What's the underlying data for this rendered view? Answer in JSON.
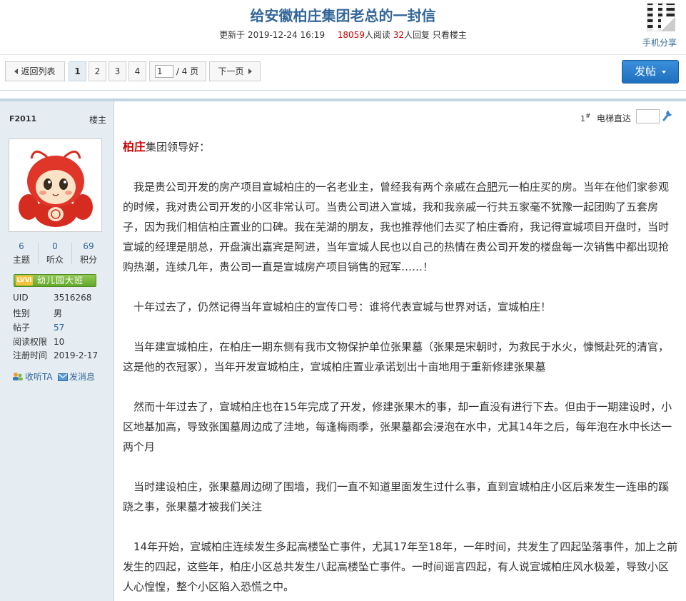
{
  "header": {
    "title": "给安徽柏庄集团老总的一封信",
    "updated_label": "更新于",
    "updated_time": "2019-12-24 16:19",
    "views": "18059",
    "views_label": "人阅读",
    "replies": "32",
    "replies_label": "人回复",
    "only_author": "只看楼主",
    "mobile_share": "手机分享"
  },
  "pager": {
    "back_label": "返回列表",
    "pages": [
      "1",
      "2",
      "3",
      "4"
    ],
    "current_page": "1",
    "jump_value": "1",
    "total_pages": "/ 4 页",
    "next_label": "下一页",
    "post_label": "发帖"
  },
  "author": {
    "name": "F2011",
    "tag": "楼主",
    "stats": {
      "topics": "6",
      "topics_label": "主题",
      "listeners": "0",
      "listeners_label": "听众",
      "points": "69",
      "points_label": "积分"
    },
    "level_badge": "LVⅥ",
    "level_name": "幼儿园大班",
    "info": {
      "uid_label": "UID",
      "uid": "3516268",
      "gender_label": "性别",
      "gender": "男",
      "posts_label": "帖子",
      "posts": "57",
      "perm_label": "阅读权限",
      "perm": "10",
      "reg_label": "注册时间",
      "reg": "2019-2-17"
    },
    "follow_label": "收听TA",
    "message_label": "发消息"
  },
  "post": {
    "floor": "1",
    "floor_mark": "#",
    "elevator_label": "电梯直达",
    "greeting_red": "柏庄",
    "greeting_rest": "集团领导好：",
    "p1_a": "我是贵公司开发的房产项目宣城柏庄的一名老业主，曾经我有两个亲戚在",
    "p1_ul": "合肥",
    "p1_b": "元一柏庄买的房。当年在他们家参观的时候，我对贵公司开发的小区非常认可。当贵公司进入宣城，我和我亲戚一行共五家毫不犹豫一起团购了五套房子，因为我们相信柏庄置业的口碑。我在芜湖的朋友，我也推荐他们去买了柏庄香府，我记得宣城项目开盘时，当时宣城的经理是朋总，开盘演出嘉宾是阿进，当年宣城人民也以自己的热情在贵公司开发的楼盘每一次销售中都出现抢购热潮，连续几年，贵公司一直是宣城房产项目销售的冠军……！",
    "p2": "十年过去了，仍然记得当年宣城柏庄的宣传口号：谁将代表宣城与世界对话，宣城柏庄！",
    "p3": "当年建宣城柏庄，在柏庄一期东侧有我市文物保护单位张果墓（张果是宋朝时，为救民于水火，慷慨赴死的清官，这是他的衣冠冢），当年开发宣城柏庄，宣城柏庄置业承诺划出十亩地用于重新修建张果墓",
    "p4": "然而十年过去了，宣城柏庄也在15年完成了开发，修建张果木的事，却一直没有进行下去。但由于一期建设时，小区地基加高，导致张国墓周边成了洼地，每逢梅雨季，张果墓都会浸泡在水中，尤其14年之后，每年泡在水中长达一两个月",
    "p5": "当时建设柏庄，张果墓周边砌了围墙，我们一直不知道里面发生过什么事，直到宣城柏庄小区后来发生一连串的蹊跷之事，张果墓才被我们关注",
    "p6": "14年开始，宣城柏庄连续发生多起高楼坠亡事件，尤其17年至18年，一年时间，共发生了四起坠落事件，加上之前发生的四起，这些年，柏庄小区总共发生八起高楼坠亡事件。一时间谣言四起，有人说宣城柏庄风水极差，导致小区人心惶惶，整个小区陷入恐慌之中。"
  },
  "colors": {
    "link": "#336699",
    "highlight": "#cc0000",
    "sidebar_bg": "#e5edf2",
    "border": "#c2d5e3",
    "post_button": "#2a7fcf"
  }
}
